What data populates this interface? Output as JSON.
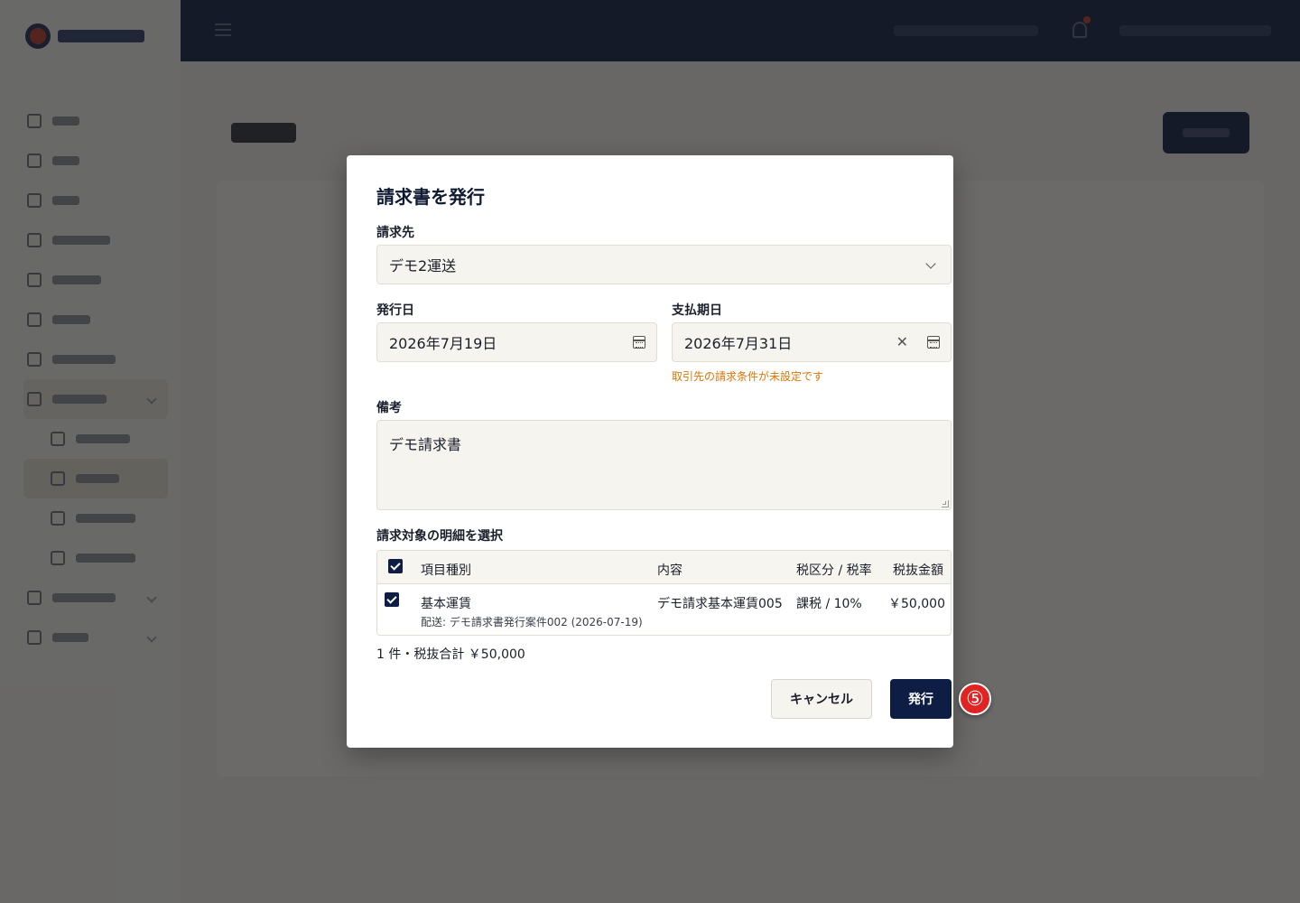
{
  "modal": {
    "title": "請求書を発行",
    "billing_to": {
      "label": "請求先",
      "value": "デモ2運送"
    },
    "issue_date": {
      "label": "発行日",
      "value": "2026年7月19日"
    },
    "due_date": {
      "label": "支払期日",
      "value": "2026年7月31日",
      "warning": "取引先の請求条件が未設定です"
    },
    "notes": {
      "label": "備考",
      "value": "デモ請求書"
    },
    "items": {
      "label": "請求対象の明細を選択",
      "headers": [
        "項目種別",
        "内容",
        "税区分 / 税率",
        "税抜金額"
      ],
      "rows": [
        {
          "type": "基本運賃",
          "detail": "配送: デモ請求書発行案件002 (2026-07-19)",
          "content": "デモ請求基本運賃005",
          "tax": "課税 / 10%",
          "amount": "￥50,000"
        }
      ]
    },
    "summary": "1 件・税抜合計 ￥50,000",
    "cancel_label": "キャンセル",
    "issue_label": "発行"
  },
  "step_badge": "⑤",
  "colors": {
    "primary": "#0e1d44",
    "warning": "#d97706",
    "badge": "#e02424"
  }
}
